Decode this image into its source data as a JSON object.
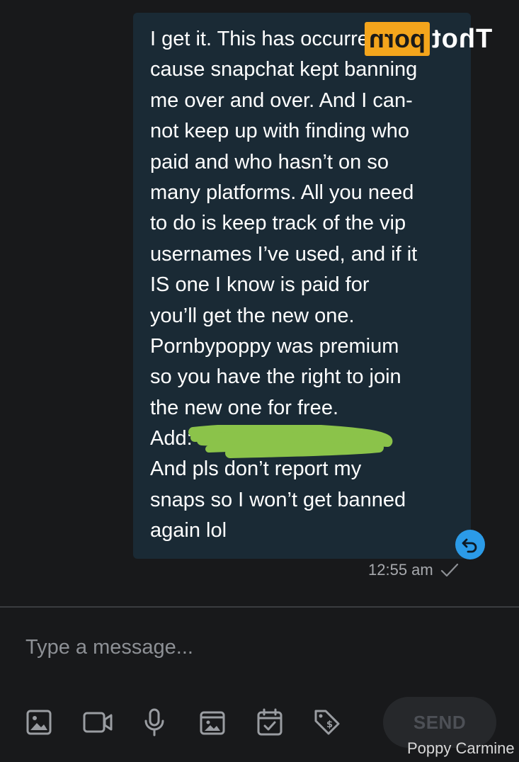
{
  "message": {
    "lines": [
      "I get it. This has occurred be-",
      "cause snapchat kept banning",
      "me over and over. And I can-",
      "not keep up with finding who",
      "paid and who hasn’t on so",
      "many platforms. All you need",
      "to do is keep track of the vip",
      "usernames I’ve used, and if it",
      "IS one I know is paid for",
      "you’ll get the new one.",
      "Pornbypoppy was premium",
      "so you have the right to join",
      "the new one for free.",
      "Add:",
      "And pls don’t report my",
      "snaps so I won’t get banned",
      "again lol"
    ],
    "timestamp": "12:55 am",
    "status_icon": "single-check-icon"
  },
  "watermark": {
    "boxed": "porn",
    "plain": "Thot"
  },
  "redaction_color": "#8bc34a",
  "composer": {
    "placeholder": "Type a message..."
  },
  "toolbar": {
    "icons": [
      "image-icon",
      "video-icon",
      "microphone-icon",
      "gallery-icon",
      "calendar-check-icon",
      "price-tag-icon"
    ],
    "send_label": "SEND"
  },
  "credit": "Poppy Carmine",
  "colors": {
    "background": "#18191b",
    "bubble": "#1a2a35",
    "accent": "#2b9be8",
    "watermark_orange": "#f4a51c"
  }
}
